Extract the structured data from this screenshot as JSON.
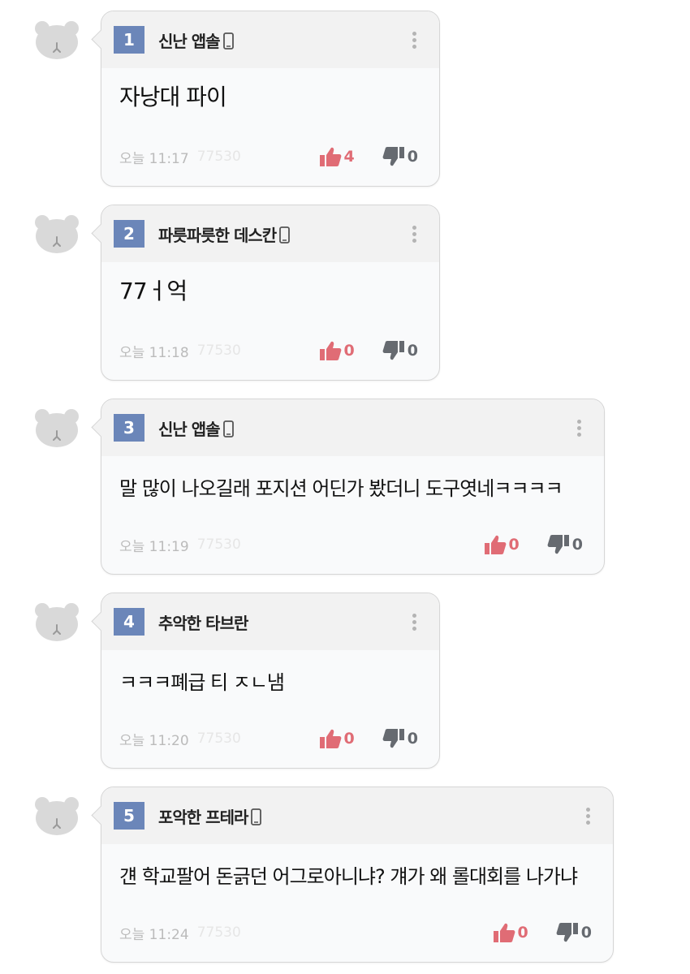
{
  "comments": [
    {
      "num": "1",
      "nick": "신난 앱솔",
      "mobile": true,
      "text": "자낭대 파이",
      "time": "오늘 11:17",
      "hits": "77530",
      "up": "4",
      "down": "0"
    },
    {
      "num": "2",
      "nick": "파릇파릇한 데스칸",
      "mobile": true,
      "text": "77ㅓ억",
      "time": "오늘 11:18",
      "hits": "77530",
      "up": "0",
      "down": "0"
    },
    {
      "num": "3",
      "nick": "신난 앱솔",
      "mobile": true,
      "text": "말 많이 나오길래 포지션 어딘가 봤더니 도구엿네ㅋㅋㅋㅋ",
      "time": "오늘 11:19",
      "hits": "77530",
      "up": "0",
      "down": "0"
    },
    {
      "num": "4",
      "nick": "추악한 타브란",
      "mobile": false,
      "text": "ㅋㅋㅋ폐급 티 ㅈㄴ냄",
      "time": "오늘 11:20",
      "hits": "77530",
      "up": "0",
      "down": "0"
    },
    {
      "num": "5",
      "nick": "포악한 프테라",
      "mobile": true,
      "text": "걘 학교팔어 돈긁던 어그로아니냐? 걔가 왜 롤대회를 나가냐",
      "time": "오늘 11:24",
      "hits": "77530",
      "up": "0",
      "down": "0"
    }
  ],
  "icons": {
    "avatar": "bear-avatar-icon",
    "mobile": "mobile-phone-icon",
    "more": "more-vertical-icon",
    "up": "thumbs-up-icon",
    "down": "thumbs-down-icon"
  },
  "colors": {
    "number_badge": "#6b86b9",
    "upvote": "#e06c75",
    "downvote": "#666a70"
  }
}
